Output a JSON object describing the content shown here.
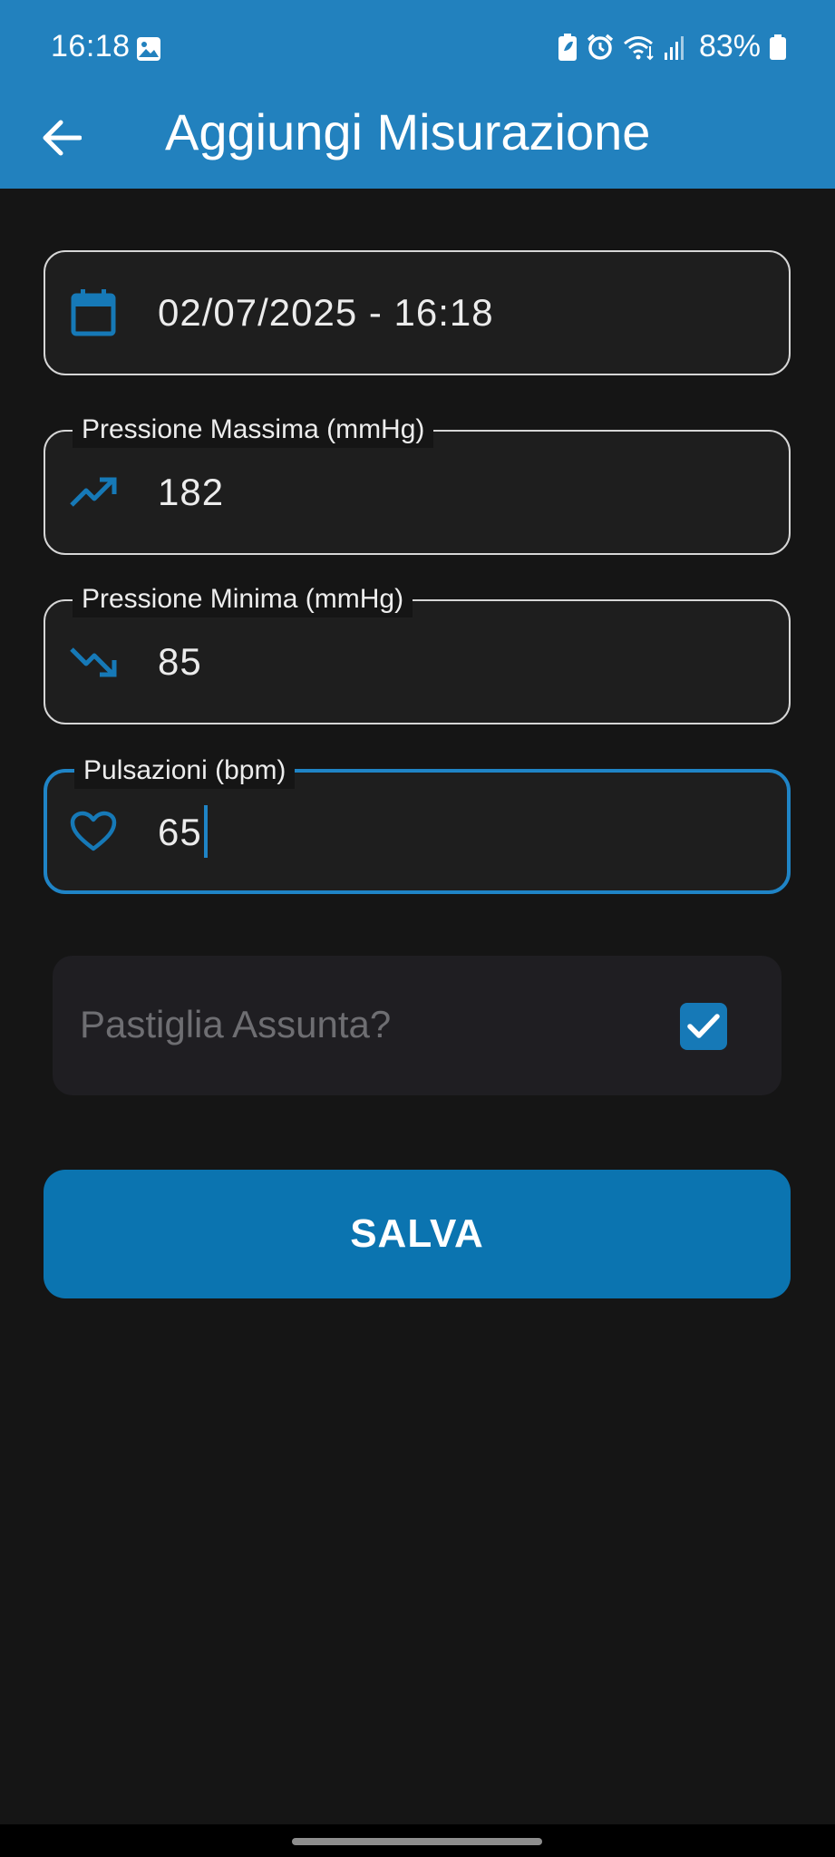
{
  "status_bar": {
    "time": "16:18",
    "battery_percent": "83%"
  },
  "app_bar": {
    "title": "Aggiungi Misurazione",
    "back_icon": "arrow-back-icon"
  },
  "form": {
    "date_field": {
      "icon": "calendar-icon",
      "value": "02/07/2025 - 16:18"
    },
    "systolic_field": {
      "label": "Pressione Massima (mmHg)",
      "icon": "trending-up-icon",
      "value": "182"
    },
    "diastolic_field": {
      "label": "Pressione Minima (mmHg)",
      "icon": "trending-down-icon",
      "value": "85"
    },
    "pulse_field": {
      "label": "Pulsazioni (bpm)",
      "icon": "heart-icon",
      "value": "65",
      "focused": true
    },
    "pill_taken": {
      "label": "Pastiglia Assunta?",
      "checked": true
    },
    "save_label": "SALVA"
  },
  "colors": {
    "app_bar": "#2281BE",
    "background": "#151515",
    "accent": "#1679B7",
    "save_button": "#0B74B0"
  }
}
